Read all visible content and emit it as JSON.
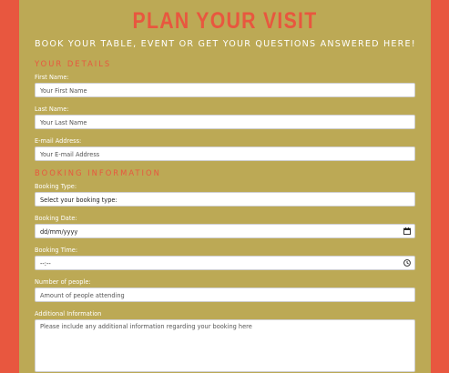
{
  "title": "PLAN YOUR VISIT",
  "subtitle": "BOOK YOUR TABLE, EVENT OR GET YOUR QUESTIONS ANSWERED HERE!",
  "sections": {
    "details": {
      "heading": "YOUR DETAILS",
      "first_name": {
        "label": "First Name:",
        "placeholder": "Your First Name"
      },
      "last_name": {
        "label": "Last Name:",
        "placeholder": "Your Last Name"
      },
      "email": {
        "label": "E-mail Address:",
        "placeholder": "Your E-mail Address"
      }
    },
    "booking": {
      "heading": "BOOKING INFORMATION",
      "type": {
        "label": "Booking Type:",
        "value": "Select your booking type:"
      },
      "date": {
        "label": "Booking Date:",
        "value": "dd/mm/yyyy"
      },
      "time": {
        "label": "Booking Time:",
        "value": "--:--"
      },
      "people": {
        "label": "Number of people:",
        "placeholder": "Amount of people attending"
      },
      "info": {
        "label": "Additional Information",
        "placeholder": "Please include any additional information regarding your booking here"
      }
    }
  },
  "icons": {
    "date": "calendar-icon",
    "time": "clock-icon"
  },
  "colors": {
    "background": "#e8573f",
    "panel": "#bca955",
    "accent": "#e8573f",
    "text": "#ffffff"
  }
}
